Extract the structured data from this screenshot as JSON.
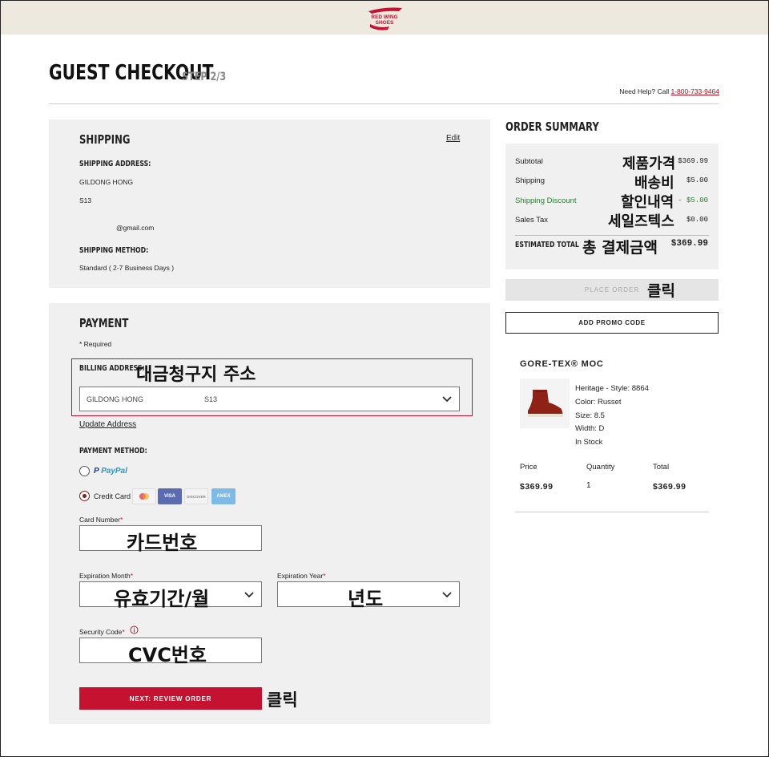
{
  "header": {
    "logo_text": "RED WING SHOES"
  },
  "page": {
    "title": "GUEST CHECKOUT",
    "step": "STEP 2/3",
    "help_prefix": "Need Help? Call ",
    "help_phone": "1-800-733-9464"
  },
  "shipping": {
    "heading": "SHIPPING",
    "edit": "Edit",
    "address_label": "SHIPPING ADDRESS:",
    "name": "GILDONG HONG",
    "line2": "S13",
    "email": "@gmail.com",
    "method_label": "SHIPPING METHOD:",
    "method": "Standard ( 2-7 Business Days )"
  },
  "payment": {
    "heading": "PAYMENT",
    "required_note": "* Required",
    "billing_label": "BILLING ADDRESS:",
    "billing_annotation": "대금청구지 주소",
    "billing_select_name": "GILDONG HONG",
    "billing_select_extra": "S13",
    "update_address": "Update Address",
    "method_label": "PAYMENT METHOD:",
    "paypal_label": "PayPal",
    "credit_label": "Credit Card",
    "card_badges": [
      "",
      "VISA",
      "DISCOVER",
      "AMEX"
    ],
    "card_number_label": "Card Number",
    "card_number_annotation": "카드번호",
    "exp_month_label": "Expiration Month",
    "exp_month_annotation": "유효기간/월",
    "exp_year_label": "Expiration Year",
    "exp_year_annotation": "년도",
    "security_label": "Security Code",
    "security_annotation": "CVC번호",
    "next_button": "NEXT: REVIEW ORDER",
    "next_annotation": "클릭",
    "required_star": "*"
  },
  "summary": {
    "heading": "ORDER SUMMARY",
    "rows": [
      {
        "label": "Subtotal",
        "annotation": "제품가격",
        "value": "$369.99"
      },
      {
        "label": "Shipping",
        "annotation": "배송비",
        "value": "$5.00"
      },
      {
        "label": "Shipping Discount",
        "annotation": "할인내역",
        "value": "- $5.00"
      },
      {
        "label": "Sales Tax",
        "annotation": "세일즈텍스",
        "value": "$0.00"
      }
    ],
    "total_label": "ESTIMATED TOTAL",
    "total_annotation": "총 결제금액",
    "total_value": "$369.99",
    "place_order": "PLACE ORDER",
    "place_order_annotation": "클릭",
    "promo": "ADD PROMO CODE",
    "discount_color": "#2e7d32"
  },
  "product": {
    "name": "GORE-TEX® MOC",
    "details": [
      "Heritage - Style: 8864",
      "Color: Russet",
      "Size: 8.5",
      "Width: D",
      "In Stock"
    ],
    "price_label": "Price",
    "quantity_label": "Quantity",
    "total_label": "Total",
    "price": "$369.99",
    "quantity": "1",
    "total": "$369.99"
  },
  "colors": {
    "brand_red": "#c41230",
    "panel_bg": "#f0f0f0",
    "header_bg": "#ede9df"
  }
}
